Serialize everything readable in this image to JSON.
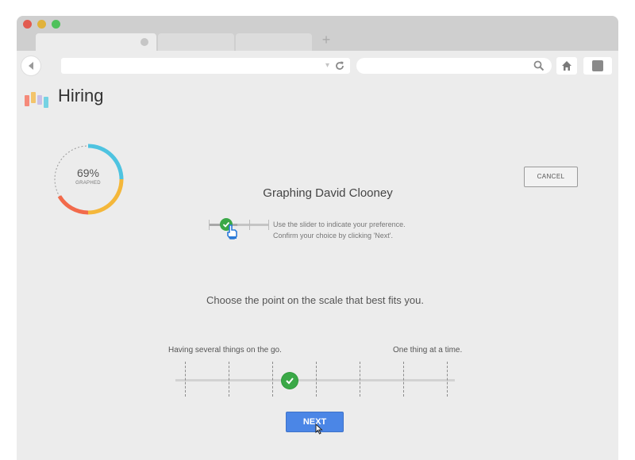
{
  "browser": {
    "controls": [
      "close",
      "minimize",
      "maximize"
    ],
    "new_tab_label": "+",
    "dropdown_glyph": "▾"
  },
  "app": {
    "brand": "Hiring",
    "logo_colors": [
      "#f58a7a",
      "#f3c46b",
      "#c9c0e6",
      "#76d2e3"
    ]
  },
  "progress": {
    "percent_label": "69%",
    "caption": "GRAPHED",
    "value": 0.69,
    "segment_colors": [
      "#4ec3e0",
      "#f4b73a",
      "#f26a4b"
    ]
  },
  "page": {
    "title": "Graphing David Clooney",
    "cancel_label": "CANCEL"
  },
  "instructions": {
    "line1": "Use the slider to indicate your preference.",
    "line2": "Confirm your choice by clicking 'Next'."
  },
  "question": {
    "prompt": "Choose the point on the scale that best fits you.",
    "left_label": "Having several things on the go.",
    "right_label": "One thing at a time.",
    "points": 7,
    "selected_index": 3
  },
  "actions": {
    "next_label": "NEXT"
  },
  "colors": {
    "accent_blue": "#4b86e6",
    "knob_green": "#3aa847"
  }
}
